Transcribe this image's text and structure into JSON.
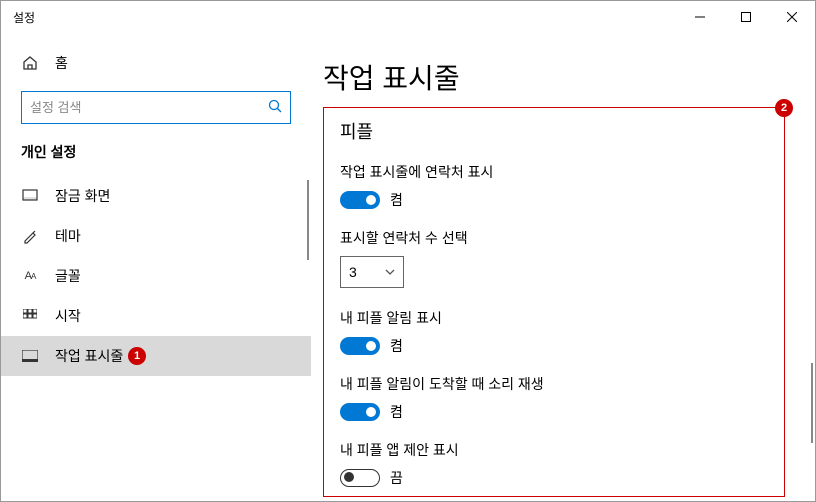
{
  "window": {
    "title": "설정"
  },
  "sidebar": {
    "home": "홈",
    "search_placeholder": "설정 검색",
    "section": "개인 설정",
    "items": [
      {
        "label": "잠금 화면"
      },
      {
        "label": "테마"
      },
      {
        "label": "글꼴"
      },
      {
        "label": "시작"
      },
      {
        "label": "작업 표시줄"
      }
    ]
  },
  "markers": {
    "m1": "1",
    "m2": "2"
  },
  "content": {
    "title": "작업 표시줄",
    "people_heading": "피플",
    "s1_label": "작업 표시줄에 연락처 표시",
    "s1_state": "켬",
    "s2_label": "표시할 연락처 수 선택",
    "s2_value": "3",
    "s3_label": "내 피플 알림 표시",
    "s3_state": "켬",
    "s4_label": "내 피플 알림이 도착할 때 소리 재생",
    "s4_state": "켬",
    "s5_label": "내 피플 앱 제안 표시",
    "s5_state": "끔"
  }
}
